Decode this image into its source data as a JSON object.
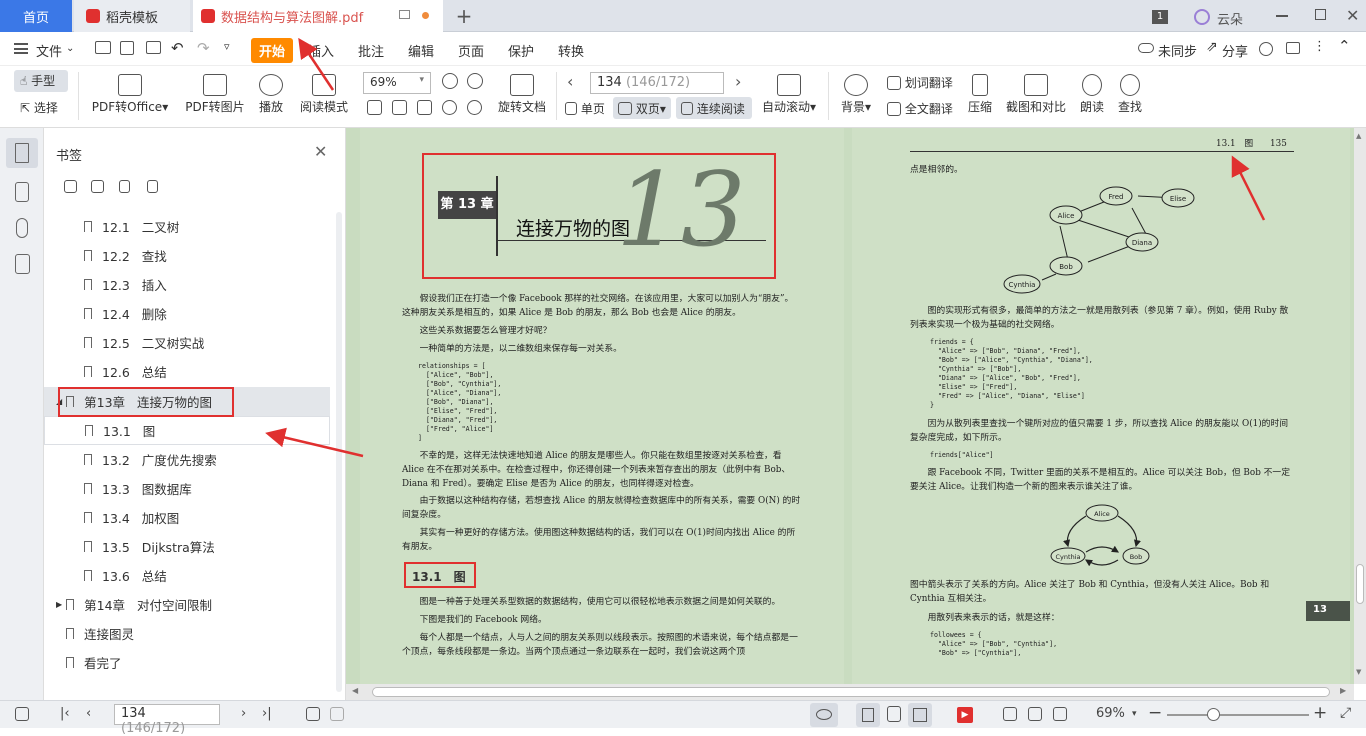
{
  "tabs": {
    "home": "首页",
    "template": "稻壳模板",
    "document": "数据结构与算法图解.pdf",
    "user": "云朵",
    "window_badge": "1"
  },
  "menu": {
    "file": "文件",
    "start": "开始",
    "insert": "插入",
    "annotate": "批注",
    "edit": "编辑",
    "page": "页面",
    "protect": "保护",
    "convert": "转换",
    "sync": "未同步",
    "share": "分享"
  },
  "toolbar": {
    "hand": "手型",
    "select": "选择",
    "pdf_to_office": "PDF转Office",
    "pdf_to_image": "PDF转图片",
    "play": "播放",
    "read_mode": "阅读模式",
    "zoom": "69%",
    "rotate": "旋转文档",
    "page_current": "134",
    "page_info": "(146/172)",
    "single": "单页",
    "double": "双页",
    "continuous": "连续阅读",
    "auto_scroll": "自动滚动",
    "background": "背景",
    "word_translate": "划词翻译",
    "full_translate": "全文翻译",
    "compress": "压缩",
    "screenshot": "截图和对比",
    "read_aloud": "朗读",
    "find": "查找"
  },
  "bookmarks": {
    "title": "书签",
    "items": [
      {
        "label": "12.1   二叉树"
      },
      {
        "label": "12.2   查找"
      },
      {
        "label": "12.3   插入"
      },
      {
        "label": "12.4   删除"
      },
      {
        "label": "12.5   二叉树实战"
      },
      {
        "label": "12.6   总结"
      },
      {
        "label": "第13章   连接万物的图"
      },
      {
        "label": "13.1   图"
      },
      {
        "label": "13.2   广度优先搜索"
      },
      {
        "label": "13.3   图数据库"
      },
      {
        "label": "13.4   加权图"
      },
      {
        "label": "13.5   Dijkstra算法"
      },
      {
        "label": "13.6   总结"
      },
      {
        "label": "第14章   对付空间限制"
      },
      {
        "label": "连接图灵"
      },
      {
        "label": "看完了"
      }
    ]
  },
  "left_page": {
    "chapter_tag": "第 13 章",
    "chapter_title": "连接万物的图",
    "chapter_number": "13",
    "p1": "假设我们正在打造一个像 Facebook 那样的社交网络。在该应用里，大家可以加别人为“朋友”。这种朋友关系是相互的，如果 Alice 是 Bob 的朋友，那么 Bob 也会是 Alice 的朋友。",
    "p2": "这些关系数据要怎么管理才好呢？",
    "p3": "一种简单的方法是，以二维数组来保存每一对关系。",
    "code": "relationships = [\n  [\"Alice\", \"Bob\"],\n  [\"Bob\", \"Cynthia\"],\n  [\"Alice\", \"Diana\"],\n  [\"Bob\", \"Diana\"],\n  [\"Elise\", \"Fred\"],\n  [\"Diana\", \"Fred\"],\n  [\"Fred\", \"Alice\"]\n]",
    "p4": "不幸的是，这样无法快速地知道 Alice 的朋友是哪些人。你只能在数组里按逐对关系检查，看 Alice 在不在那对关系中。在检查过程中，你还得创建一个列表来暂存查出的朋友（此例中有 Bob、Diana 和 Fred）。要确定 Elise 是否为 Alice 的朋友，也同样得逐对检查。",
    "p5": "由于数据以这种结构存储，若想查找 Alice 的朋友就得检查数据库中的所有关系，需要 O(N) 的时间复杂度。",
    "p6": "其实有一种更好的存储方法。使用图这种数据结构的话，我们可以在 O(1)时间内找出 Alice 的所有朋友。",
    "section": "13.1　图",
    "p7": "图是一种善于处理关系型数据的数据结构，使用它可以很轻松地表示数据之间是如何关联的。",
    "p8": "下图是我们的 Facebook 网络。",
    "p9": "每个人都是一个结点，人与人之间的朋友关系则以线段表示。按照图的术语来说，每个结点都是一个顶点，每条线段都是一条边。当两个顶点通过一条边联系在一起时，我们会说这两个顶"
  },
  "right_page": {
    "header_section": "13.1　图",
    "header_page": "135",
    "p0": "点是相邻的。",
    "graph_nodes": [
      "Fred",
      "Elise",
      "Alice",
      "Diana",
      "Bob",
      "Cynthia"
    ],
    "p1": "图的实现形式有很多，最简单的方法之一就是用散列表（参见第 7 章）。例如，使用 Ruby 散列表来实现一个极为基础的社交网络。",
    "code1": "friends = {\n  \"Alice\" => [\"Bob\", \"Diana\", \"Fred\"],\n  \"Bob\" => [\"Alice\", \"Cynthia\", \"Diana\"],\n  \"Cynthia\" => [\"Bob\"],\n  \"Diana\" => [\"Alice\", \"Bob\", \"Fred\"],\n  \"Elise\" => [\"Fred\"],\n  \"Fred\" => [\"Alice\", \"Diana\", \"Elise\"]\n}",
    "p2": "因为从散列表里查找一个键所对应的值只需要 1 步，所以查找 Alice 的朋友能以 O(1)的时间复杂度完成，如下所示。",
    "code2": "friends[\"Alice\"]",
    "p3": "跟 Facebook 不同，Twitter 里面的关系不是相互的。Alice 可以关注 Bob，但 Bob 不一定要关注 Alice。让我们构造一个新的图来表示谁关注了谁。",
    "graph2_nodes": [
      "Alice",
      "Cynthia",
      "Bob"
    ],
    "p4": "图中箭头表示了关系的方向。Alice 关注了 Bob 和 Cynthia，但没有人关注 Alice。Bob 和 Cynthia 互相关注。",
    "p5": "用散列表来表示的话，就是这样：",
    "code3": "followees = {\n  \"Alice\" => [\"Bob\", \"Cynthia\"],\n  \"Bob\" => [\"Cynthia\"],",
    "side_tab": "13"
  },
  "statusbar": {
    "page_current": "134",
    "page_info": "(146/172)",
    "zoom": "69%"
  },
  "colors": {
    "accent": "#ff8a00",
    "home_tab": "#3b78e7",
    "page_bg": "#cfe0c6",
    "annotation_red": "#e0302f"
  }
}
